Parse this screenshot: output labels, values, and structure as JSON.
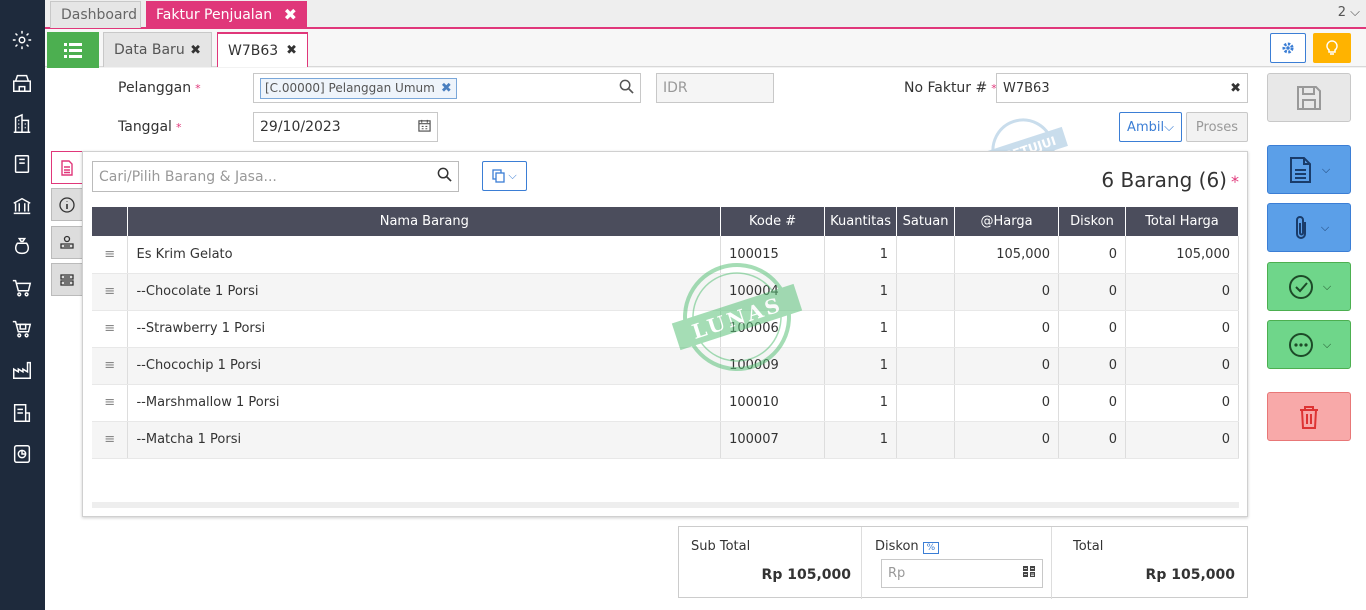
{
  "tabs_top": {
    "dashboard": "Dashboard",
    "active": "Faktur Penjualan",
    "count": "2"
  },
  "tabs_sub": {
    "t1": "Data Baru",
    "t2": "W7B63"
  },
  "form": {
    "pelanggan_label": "Pelanggan",
    "pelanggan_value": "[C.00000] Pelanggan Umum",
    "currency": "IDR",
    "tanggal_label": "Tanggal",
    "tanggal_value": "29/10/2023",
    "nofaktur_label": "No Faktur #",
    "nofaktur_value": "W7B63",
    "ambil": "Ambil",
    "proses": "Proses"
  },
  "items": {
    "search_placeholder": "Cari/Pilih Barang & Jasa...",
    "count": "6 Barang (6)",
    "columns": [
      "Nama Barang",
      "Kode #",
      "Kuantitas",
      "Satuan",
      "@Harga",
      "Diskon",
      "Total Harga"
    ],
    "rows": [
      {
        "name": "Es Krim Gelato",
        "kode": "100015",
        "qty": "1",
        "satuan": "",
        "harga": "105,000",
        "diskon": "0",
        "total": "105,000"
      },
      {
        "name": "--Chocolate 1 Porsi",
        "kode": "100004",
        "qty": "1",
        "satuan": "",
        "harga": "0",
        "diskon": "0",
        "total": "0"
      },
      {
        "name": "--Strawberry 1 Porsi",
        "kode": "100006",
        "qty": "1",
        "satuan": "",
        "harga": "0",
        "diskon": "0",
        "total": "0"
      },
      {
        "name": "--Chocochip 1 Porsi",
        "kode": "100009",
        "qty": "1",
        "satuan": "",
        "harga": "0",
        "diskon": "0",
        "total": "0"
      },
      {
        "name": "--Marshmallow 1 Porsi",
        "kode": "100010",
        "qty": "1",
        "satuan": "",
        "harga": "0",
        "diskon": "0",
        "total": "0"
      },
      {
        "name": "--Matcha 1 Porsi",
        "kode": "100007",
        "qty": "1",
        "satuan": "",
        "harga": "0",
        "diskon": "0",
        "total": "0"
      }
    ]
  },
  "stamps": {
    "disetujui": "DISETUJUI",
    "lunas": "LUNAS"
  },
  "totals": {
    "subtotal_label": "Sub Total",
    "subtotal_value": "Rp 105,000",
    "diskon_label": "Diskon",
    "diskon_pct": "%",
    "diskon_prefix": "Rp",
    "total_label": "Total",
    "total_value": "Rp 105,000"
  },
  "colors": {
    "accent": "#e0377a",
    "sidebar": "#1e2a3c",
    "green": "#4caf50",
    "blue": "#3b7ed5"
  }
}
